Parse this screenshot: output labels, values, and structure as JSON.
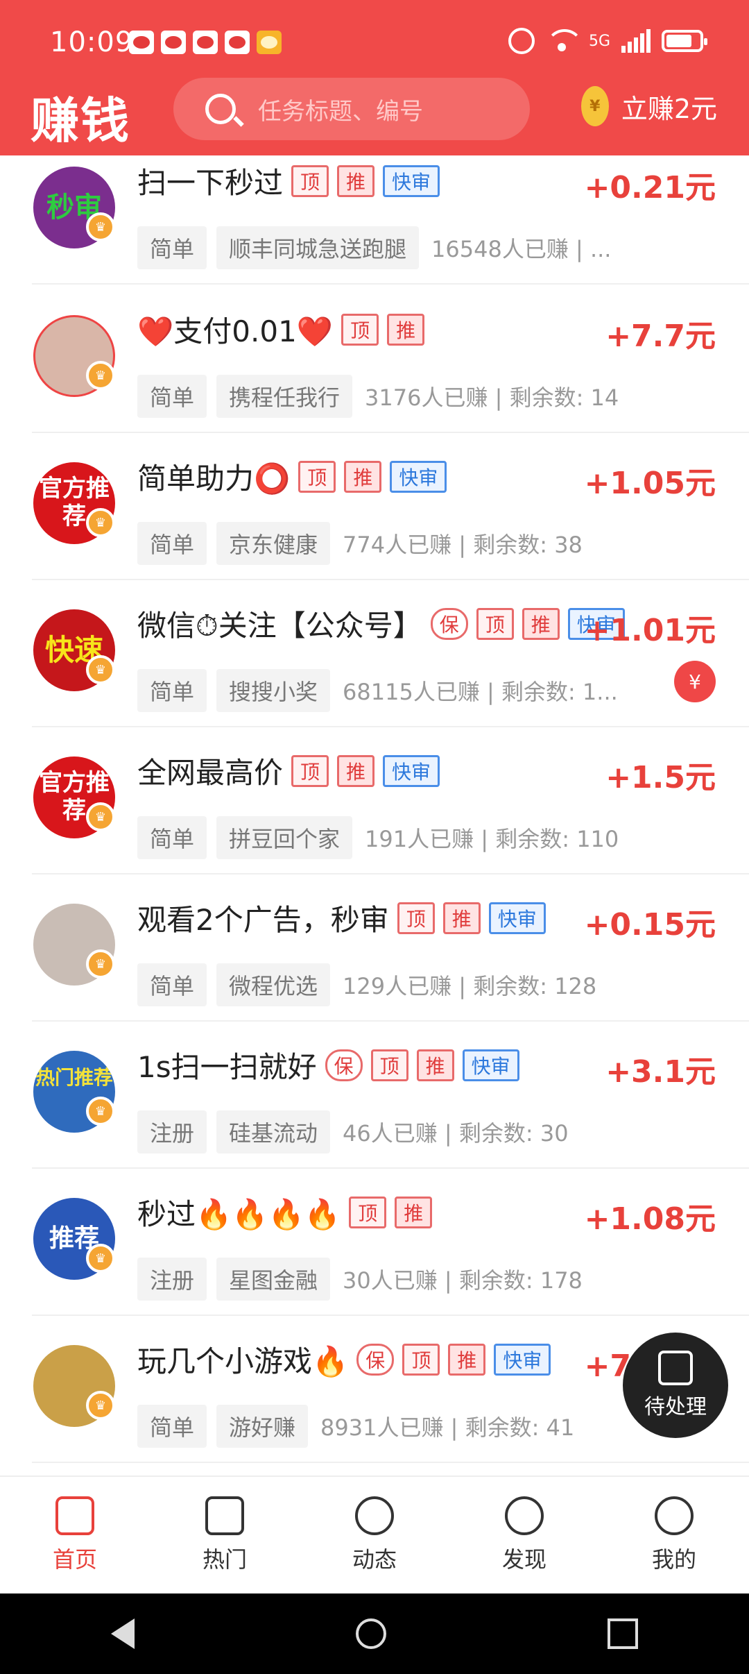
{
  "status": {
    "time": "10:09",
    "network": "5G"
  },
  "header": {
    "logo": "赚钱",
    "search_placeholder": "任务标题、编号",
    "earn_label": "立赚2元",
    "coin_symbol": "¥"
  },
  "items": [
    {
      "title": "扫一下秒过",
      "tags": [
        "顶",
        "推",
        "快审"
      ],
      "reward": "+0.21元",
      "category": "简单",
      "merchant": "顺丰同城急送跑腿",
      "stats": "16548人已赚 | ...",
      "avatar_text": "秒审",
      "avatar_color": "#7b2e8e"
    },
    {
      "title": "❤️支付0.01❤️",
      "tags": [
        "顶",
        "推"
      ],
      "reward": "+7.7元",
      "category": "简单",
      "merchant": "携程任我行",
      "stats": "3176人已赚 | 剩余数: 14",
      "avatar_text": "",
      "avatar_color": "#d9b6a8"
    },
    {
      "title": "简单助力⭕",
      "tags": [
        "顶",
        "推",
        "快审"
      ],
      "reward": "+1.05元",
      "category": "简单",
      "merchant": "京东健康",
      "stats": "774人已赚 | 剩余数: 38",
      "avatar_text": "官方推荐",
      "avatar_color": "#d8161b"
    },
    {
      "title": "微信⏱关注【公众号】",
      "tags": [
        "保",
        "顶",
        "推",
        "快审"
      ],
      "reward": "+1.01元",
      "category": "简单",
      "merchant": "搜搜小奖",
      "stats": "68115人已赚 | 剩余数: 1...",
      "avatar_text": "快速",
      "avatar_color": "#c5171b",
      "badge": "¥"
    },
    {
      "title": "全网最高价",
      "tags": [
        "顶",
        "推",
        "快审"
      ],
      "reward": "+1.5元",
      "category": "简单",
      "merchant": "拼豆回个家",
      "stats": "191人已赚 | 剩余数: 110",
      "avatar_text": "官方推荐",
      "avatar_color": "#d8161b"
    },
    {
      "title": "观看2个广告，秒审",
      "tags": [
        "顶",
        "推",
        "快审"
      ],
      "reward": "+0.15元",
      "category": "简单",
      "merchant": "微程优选",
      "stats": "129人已赚 | 剩余数: 128",
      "avatar_text": "",
      "avatar_color": "#c9bdb5"
    },
    {
      "title": "1s扫一扫就好",
      "tags": [
        "保",
        "顶",
        "推",
        "快审"
      ],
      "reward": "+3.1元",
      "category": "注册",
      "merchant": "硅基流动",
      "stats": "46人已赚 | 剩余数: 30",
      "avatar_text": "热门推荐",
      "avatar_color": "#2f6bbd"
    },
    {
      "title": "秒过🔥🔥🔥🔥",
      "tags": [
        "顶",
        "推"
      ],
      "reward": "+1.08元",
      "category": "注册",
      "merchant": "星图金融",
      "stats": "30人已赚 | 剩余数: 178",
      "avatar_text": "推荐",
      "avatar_color": "#2a58b8"
    },
    {
      "title": "玩几个小游戏🔥",
      "tags": [
        "保",
        "顶",
        "推",
        "快审"
      ],
      "reward": "+7.19元",
      "category": "简单",
      "merchant": "游好赚",
      "stats": "8931人已赚 | 剩余数: 41",
      "avatar_text": "",
      "avatar_color": "#caa048"
    }
  ],
  "float_button": {
    "label": "待处理"
  },
  "tabs": [
    {
      "label": "首页",
      "icon": "home-icon",
      "active": true
    },
    {
      "label": "热门",
      "icon": "hot-icon"
    },
    {
      "label": "动态",
      "icon": "broadcast-icon"
    },
    {
      "label": "发现",
      "icon": "compass-icon"
    },
    {
      "label": "我的",
      "icon": "profile-icon"
    }
  ],
  "colors": {
    "brand": "#f04a49",
    "reward": "#e8413b"
  }
}
